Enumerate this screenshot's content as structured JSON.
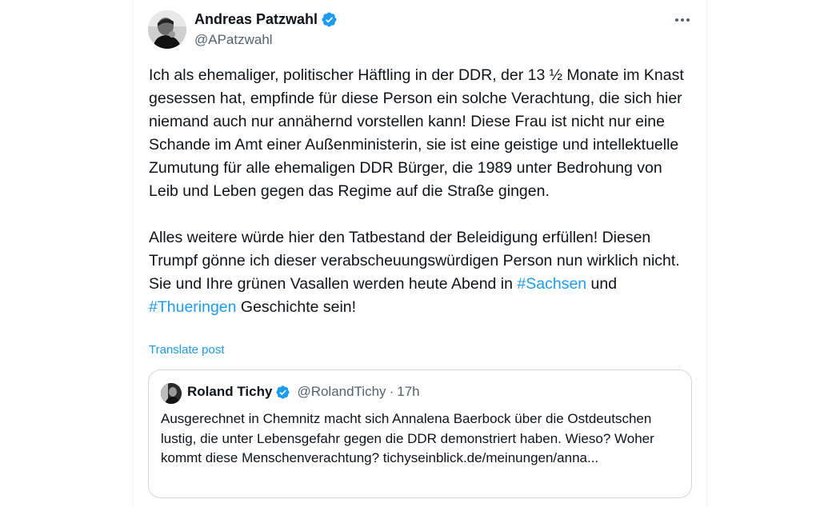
{
  "author": {
    "name": "Andreas Patzwahl",
    "handle": "@APatzwahl"
  },
  "post": {
    "p1": "Ich als ehemaliger, politischer Häftling in der DDR, der 13 ½ Monate im Knast gesessen hat, empfinde für diese Person ein solche Verachtung, die sich hier niemand auch nur annähernd vorstellen kann! Diese Frau ist nicht nur eine Schande im Amt einer Außenministerin, sie ist eine geistige und intellektuelle Zumutung für alle ehemaligen DDR Bürger, die 1989 unter Bedrohung von Leib und Leben gegen das Regime auf die Straße gingen.",
    "p2_text_a": "Alles weitere würde hier den Tatbestand der Beleidigung erfüllen! Diesen Trumpf gönne ich dieser verabscheuungswürdigen Person nun wirklich nicht. Sie und Ihre grünen Vasallen werden heute Abend in ",
    "hashtag_1": "#Sachsen",
    "p2_text_b": " und ",
    "hashtag_2": "#Thueringen",
    "p2_text_c": " Geschichte sein!"
  },
  "translate_label": "Translate post",
  "quote": {
    "name": "Roland Tichy",
    "handle": "@RolandTichy",
    "separator": "·",
    "time": "17h",
    "text": "Ausgerechnet in Chemnitz macht sich Annalena Baerbock über die Ostdeutschen lustig, die unter Lebensgefahr gegen die DDR demonstriert haben. Wieso? Woher kommt diese Menschenverachtung?  tichyseinblick.de/meinungen/anna..."
  },
  "icons": {
    "verified": "verified-badge-icon",
    "more": "more-options-icon"
  },
  "colors": {
    "link": "#1d9bf0",
    "text": "#0f1419",
    "secondary": "#536471",
    "border": "#cfd9de"
  }
}
